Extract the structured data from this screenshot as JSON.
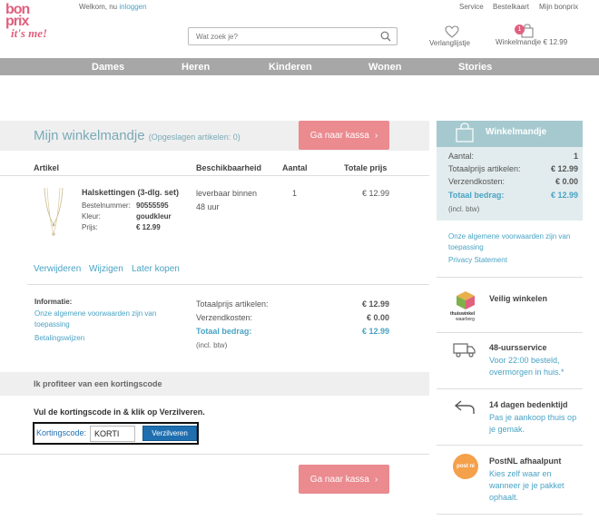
{
  "logo": {
    "line1": "bon",
    "line2": "prix",
    "line3": "it's me!"
  },
  "top": {
    "welcome": "Welkom, nu",
    "login": "inloggen",
    "links": [
      "Service",
      "Bestelkaart",
      "Mijn bonprix"
    ],
    "wishlist": "Verlanglijstje",
    "cart_label": "Winkelmandje € 12.99",
    "cart_count": "1"
  },
  "search": {
    "placeholder": "Wat zoek je?"
  },
  "nav": [
    "Dames",
    "Heren",
    "Kinderen",
    "Wonen",
    "Stories"
  ],
  "cart": {
    "title": "Mijn winkelmandje",
    "saved": "(Opgeslagen artikelen: 0)",
    "checkout": "Ga naar kassa",
    "headers": {
      "article": "Artikel",
      "availability": "Beschikbaarheid",
      "qty": "Aantal",
      "total": "Totale prijs"
    },
    "item": {
      "name": "Halskettingen (3-dlg. set)",
      "order_label": "Bestelnummer:",
      "order_value": "90555595",
      "color_label": "Kleur:",
      "color_value": "goudkleur",
      "price_label": "Prijs:",
      "price_value": "€ 12.99",
      "availability_line1": "leverbaar binnen",
      "availability_line2": "48 uur",
      "qty": "1",
      "total": "€ 12.99"
    },
    "actions": [
      "Verwijderen",
      "Wijzigen",
      "Later kopen"
    ],
    "info": {
      "title": "Informatie:",
      "link1_line1": "Onze algemene voorwaarden zijn van",
      "link1_line2": "toepassing",
      "link2": "Betalingswijzen"
    },
    "summary": {
      "subtotal_label": "Totaalprijs artikelen:",
      "subtotal": "€ 12.99",
      "shipping_label": "Verzendkosten:",
      "shipping": "€ 0.00",
      "total_label": "Totaal bedrag:",
      "total": "€ 12.99",
      "vat": "(incl. btw)"
    }
  },
  "coupon": {
    "title": "Ik profiteer van een kortingscode",
    "instruction": "Vul de kortingscode in & klik op Verzilveren.",
    "label": "Kortingscode:",
    "value": "KORTI",
    "button": "Verzilveren"
  },
  "sidebar": {
    "title": "Winkelmandje",
    "rows": [
      {
        "label": "Aantal:",
        "value": "1"
      },
      {
        "label": "Totaalprijs artikelen:",
        "value": "€ 12.99"
      },
      {
        "label": "Verzendkosten:",
        "value": "€ 0.00"
      }
    ],
    "total_label": "Totaal bedrag:",
    "total": "€ 12.99",
    "vat": "(incl. btw)",
    "link1_line1": "Onze algemene voorwaarden zijn van",
    "link1_line2": "toepassing",
    "link2": "Privacy Statement",
    "services": [
      {
        "title": "Veilig winkelen",
        "line1": "",
        "line2": "",
        "icon": "thuiswinkel-waarborg-icon",
        "icon_text1": "thuiswinkel",
        "icon_text2": "waarborg"
      },
      {
        "title": "48-uursservice",
        "line1": "Voor 22:00 besteld,",
        "line2": "overmorgen in huis.*",
        "icon": "truck-icon"
      },
      {
        "title": "14 dagen bedenktijd",
        "line1": "Pas je aankoop thuis op",
        "line2": "je gemak.",
        "icon": "return-arrow-icon"
      },
      {
        "title": "PostNL afhaalpunt",
        "line1": "Kies zelf waar en",
        "line2": "wanneer je je pakket",
        "line3": "ophaalt.",
        "icon": "postnl-icon",
        "icon_text": "post nl"
      }
    ]
  },
  "colors": {
    "accent": "#4aa3c4",
    "checkout": "#eb8a8f",
    "nav": "#a7a7a7",
    "brand": "#e0607e"
  }
}
